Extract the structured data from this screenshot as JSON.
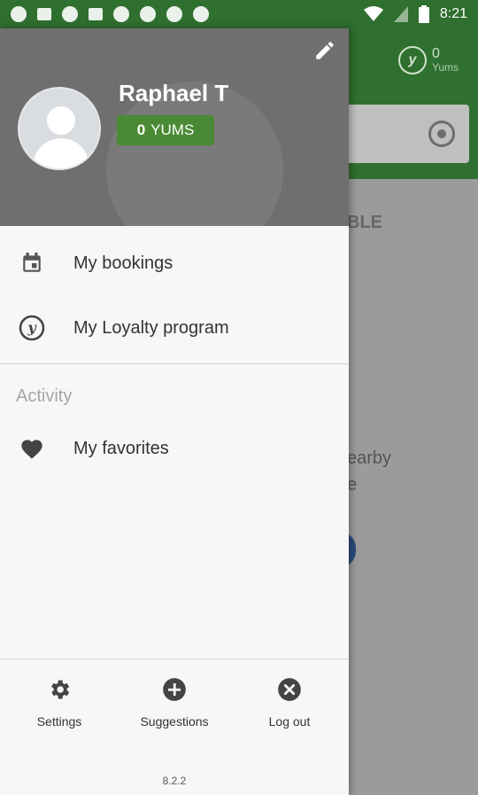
{
  "status_bar": {
    "time": "8:21",
    "left_icons": [
      "whatsapp-icon",
      "notification-icon",
      "cat-icon",
      "esc-icon",
      "pinterest-icon",
      "cat-icon",
      "pinterest-icon",
      "pinterest-icon"
    ],
    "right_icons": [
      "wifi-icon",
      "no-signal-icon",
      "battery-charging-icon"
    ]
  },
  "background": {
    "yums_value": "0",
    "yums_label": "Yums",
    "text_available": "BLE",
    "text_nearby_line1": "earby",
    "text_nearby_line2": "e"
  },
  "drawer": {
    "user_name": "Raphael T",
    "yums_button": {
      "value": "0",
      "label": "YUMS"
    },
    "menu": [
      {
        "label": "My bookings",
        "icon": "calendar-icon"
      },
      {
        "label": "My Loyalty program",
        "icon": "loyalty-logo-icon"
      }
    ],
    "activity_section": "Activity",
    "activity_items": [
      {
        "label": "My favorites",
        "icon": "heart-icon"
      }
    ],
    "bottom": [
      {
        "label": "Settings",
        "icon": "gear-icon"
      },
      {
        "label": "Suggestions",
        "icon": "plus-circle-icon"
      },
      {
        "label": "Log out",
        "icon": "close-circle-icon"
      }
    ],
    "version": "8.2.2"
  },
  "colors": {
    "status_bar": "#2f6f2f",
    "header_bg": "#6f6f6f",
    "yums_button": "#4a8a34",
    "drawer_bg": "#f7f7f7"
  }
}
